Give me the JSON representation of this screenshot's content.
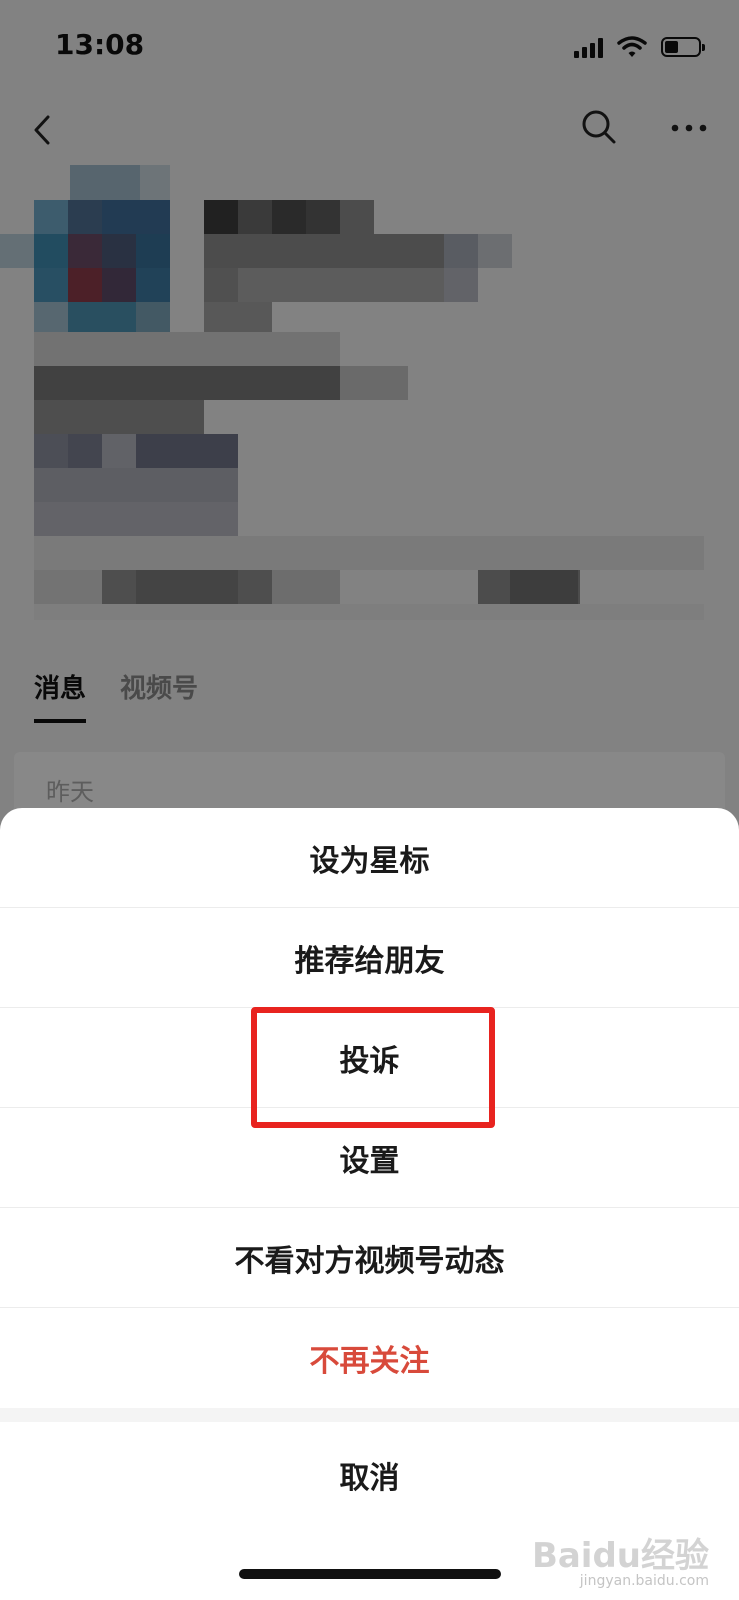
{
  "status_bar": {
    "time": "13:08"
  },
  "profile": {
    "tabs": [
      {
        "label": "消息",
        "active": true
      },
      {
        "label": "视频号",
        "active": false
      }
    ],
    "feed_date": "昨天"
  },
  "action_sheet": {
    "items": [
      {
        "label": "设为星标"
      },
      {
        "label": "推荐给朋友"
      },
      {
        "label": "投诉"
      },
      {
        "label": "设置"
      },
      {
        "label": "不看对方视频号动态"
      },
      {
        "label": "不再关注"
      }
    ],
    "cancel_label": "取消"
  },
  "colors": {
    "danger": "#d84a3b",
    "highlight": "#e8231f"
  },
  "icons": {
    "back": "chevron-left-icon",
    "search": "search-icon",
    "more": "more-icon"
  },
  "watermark": {
    "brand": "Baidu经验",
    "url": "jingyan.baidu.com"
  }
}
